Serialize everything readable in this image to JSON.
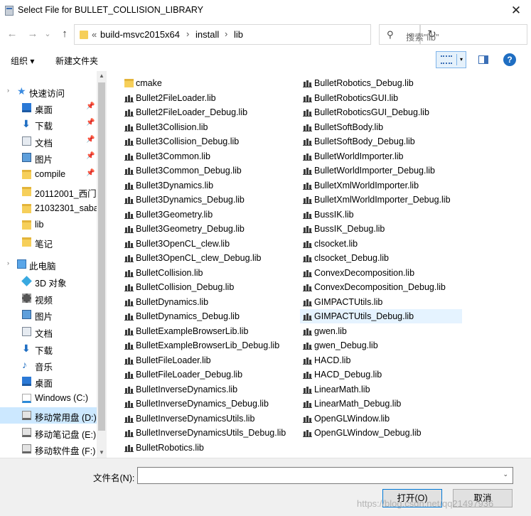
{
  "title": "Select File for BULLET_COLLISION_LIBRARY",
  "close_glyph": "✕",
  "nav": {
    "back": "←",
    "forward": "→",
    "recent": "⌄",
    "up": "↑"
  },
  "address": {
    "overflow": "«",
    "segments": [
      "build-msvc2015x64",
      "install",
      "lib"
    ],
    "separator": "›",
    "dropdown": "⌄",
    "refresh": "↻"
  },
  "search": {
    "icon": "⚲",
    "placeholder": "搜索\"lib\""
  },
  "toolbar": {
    "organize": "组织 ▾",
    "new_folder": "新建文件夹",
    "help": "?"
  },
  "sidebar": {
    "pin": "📌",
    "expand": "›",
    "items": [
      {
        "label": "快速访问",
        "icon": "star",
        "level": 0
      },
      {
        "label": "桌面",
        "icon": "desk",
        "level": 1,
        "pinned": true
      },
      {
        "label": "下载",
        "icon": "down",
        "level": 1,
        "pinned": true
      },
      {
        "label": "文档",
        "icon": "doc",
        "level": 1,
        "pinned": true
      },
      {
        "label": "图片",
        "icon": "pic",
        "level": 1,
        "pinned": true
      },
      {
        "label": "compile",
        "icon": "fold",
        "level": 1,
        "pinned": true
      },
      {
        "label": "20112001_西门",
        "icon": "fold",
        "level": 1
      },
      {
        "label": "21032301_saba",
        "icon": "fold",
        "level": 1
      },
      {
        "label": "lib",
        "icon": "fold",
        "level": 1
      },
      {
        "label": "笔记",
        "icon": "fold",
        "level": 1
      },
      {
        "label": "此电脑",
        "icon": "pc",
        "level": 0
      },
      {
        "label": "3D 对象",
        "icon": "3d",
        "level": 1
      },
      {
        "label": "视频",
        "icon": "vid",
        "level": 1
      },
      {
        "label": "图片",
        "icon": "pic",
        "level": 1
      },
      {
        "label": "文档",
        "icon": "doc",
        "level": 1
      },
      {
        "label": "下载",
        "icon": "down",
        "level": 1
      },
      {
        "label": "音乐",
        "icon": "mus",
        "level": 1
      },
      {
        "label": "桌面",
        "icon": "desk",
        "level": 1
      },
      {
        "label": "Windows (C:)",
        "icon": "win",
        "level": 1
      },
      {
        "label": "移动常用盘 (D:)",
        "icon": "drv",
        "level": 1,
        "selected": true
      },
      {
        "label": "移动笔记盘 (E:)",
        "icon": "drv",
        "level": 1
      },
      {
        "label": "移动软件盘 (F:)",
        "icon": "drv",
        "level": 1
      }
    ]
  },
  "scroll_arrows": {
    "up": "▲",
    "down": "▼"
  },
  "files": {
    "col1": [
      {
        "name": "cmake",
        "type": "folder"
      },
      {
        "name": "Bullet2FileLoader.lib",
        "type": "lib"
      },
      {
        "name": "Bullet2FileLoader_Debug.lib",
        "type": "lib"
      },
      {
        "name": "Bullet3Collision.lib",
        "type": "lib"
      },
      {
        "name": "Bullet3Collision_Debug.lib",
        "type": "lib"
      },
      {
        "name": "Bullet3Common.lib",
        "type": "lib"
      },
      {
        "name": "Bullet3Common_Debug.lib",
        "type": "lib"
      },
      {
        "name": "Bullet3Dynamics.lib",
        "type": "lib"
      },
      {
        "name": "Bullet3Dynamics_Debug.lib",
        "type": "lib"
      },
      {
        "name": "Bullet3Geometry.lib",
        "type": "lib"
      },
      {
        "name": "Bullet3Geometry_Debug.lib",
        "type": "lib"
      },
      {
        "name": "Bullet3OpenCL_clew.lib",
        "type": "lib"
      },
      {
        "name": "Bullet3OpenCL_clew_Debug.lib",
        "type": "lib"
      },
      {
        "name": "BulletCollision.lib",
        "type": "lib"
      },
      {
        "name": "BulletCollision_Debug.lib",
        "type": "lib"
      },
      {
        "name": "BulletDynamics.lib",
        "type": "lib"
      },
      {
        "name": "BulletDynamics_Debug.lib",
        "type": "lib"
      },
      {
        "name": "BulletExampleBrowserLib.lib",
        "type": "lib"
      },
      {
        "name": "BulletExampleBrowserLib_Debug.lib",
        "type": "lib"
      },
      {
        "name": "BulletFileLoader.lib",
        "type": "lib"
      },
      {
        "name": "BulletFileLoader_Debug.lib",
        "type": "lib"
      },
      {
        "name": "BulletInverseDynamics.lib",
        "type": "lib"
      },
      {
        "name": "BulletInverseDynamics_Debug.lib",
        "type": "lib"
      },
      {
        "name": "BulletInverseDynamicsUtils.lib",
        "type": "lib"
      },
      {
        "name": "BulletInverseDynamicsUtils_Debug.lib",
        "type": "lib"
      },
      {
        "name": "BulletRobotics.lib",
        "type": "lib"
      }
    ],
    "col2": [
      {
        "name": "BulletRobotics_Debug.lib",
        "type": "lib"
      },
      {
        "name": "BulletRoboticsGUI.lib",
        "type": "lib"
      },
      {
        "name": "BulletRoboticsGUI_Debug.lib",
        "type": "lib"
      },
      {
        "name": "BulletSoftBody.lib",
        "type": "lib"
      },
      {
        "name": "BulletSoftBody_Debug.lib",
        "type": "lib"
      },
      {
        "name": "BulletWorldImporter.lib",
        "type": "lib"
      },
      {
        "name": "BulletWorldImporter_Debug.lib",
        "type": "lib"
      },
      {
        "name": "BulletXmlWorldImporter.lib",
        "type": "lib"
      },
      {
        "name": "BulletXmlWorldImporter_Debug.lib",
        "type": "lib"
      },
      {
        "name": "BussIK.lib",
        "type": "lib"
      },
      {
        "name": "BussIK_Debug.lib",
        "type": "lib"
      },
      {
        "name": "clsocket.lib",
        "type": "lib"
      },
      {
        "name": "clsocket_Debug.lib",
        "type": "lib"
      },
      {
        "name": "ConvexDecomposition.lib",
        "type": "lib"
      },
      {
        "name": "ConvexDecomposition_Debug.lib",
        "type": "lib"
      },
      {
        "name": "GIMPACTUtils.lib",
        "type": "lib"
      },
      {
        "name": "GIMPACTUtils_Debug.lib",
        "type": "lib",
        "highlighted": true
      },
      {
        "name": "gwen.lib",
        "type": "lib"
      },
      {
        "name": "gwen_Debug.lib",
        "type": "lib"
      },
      {
        "name": "HACD.lib",
        "type": "lib"
      },
      {
        "name": "HACD_Debug.lib",
        "type": "lib"
      },
      {
        "name": "LinearMath.lib",
        "type": "lib"
      },
      {
        "name": "LinearMath_Debug.lib",
        "type": "lib"
      },
      {
        "name": "OpenGLWindow.lib",
        "type": "lib"
      },
      {
        "name": "OpenGLWindow_Debug.lib",
        "type": "lib"
      }
    ]
  },
  "filename": {
    "label": "文件名(N):",
    "value": "",
    "dropdown": "⌄"
  },
  "buttons": {
    "open": "打开(O)",
    "cancel": "取消"
  },
  "watermark": "https://blog.csdn.net/qq21497936"
}
